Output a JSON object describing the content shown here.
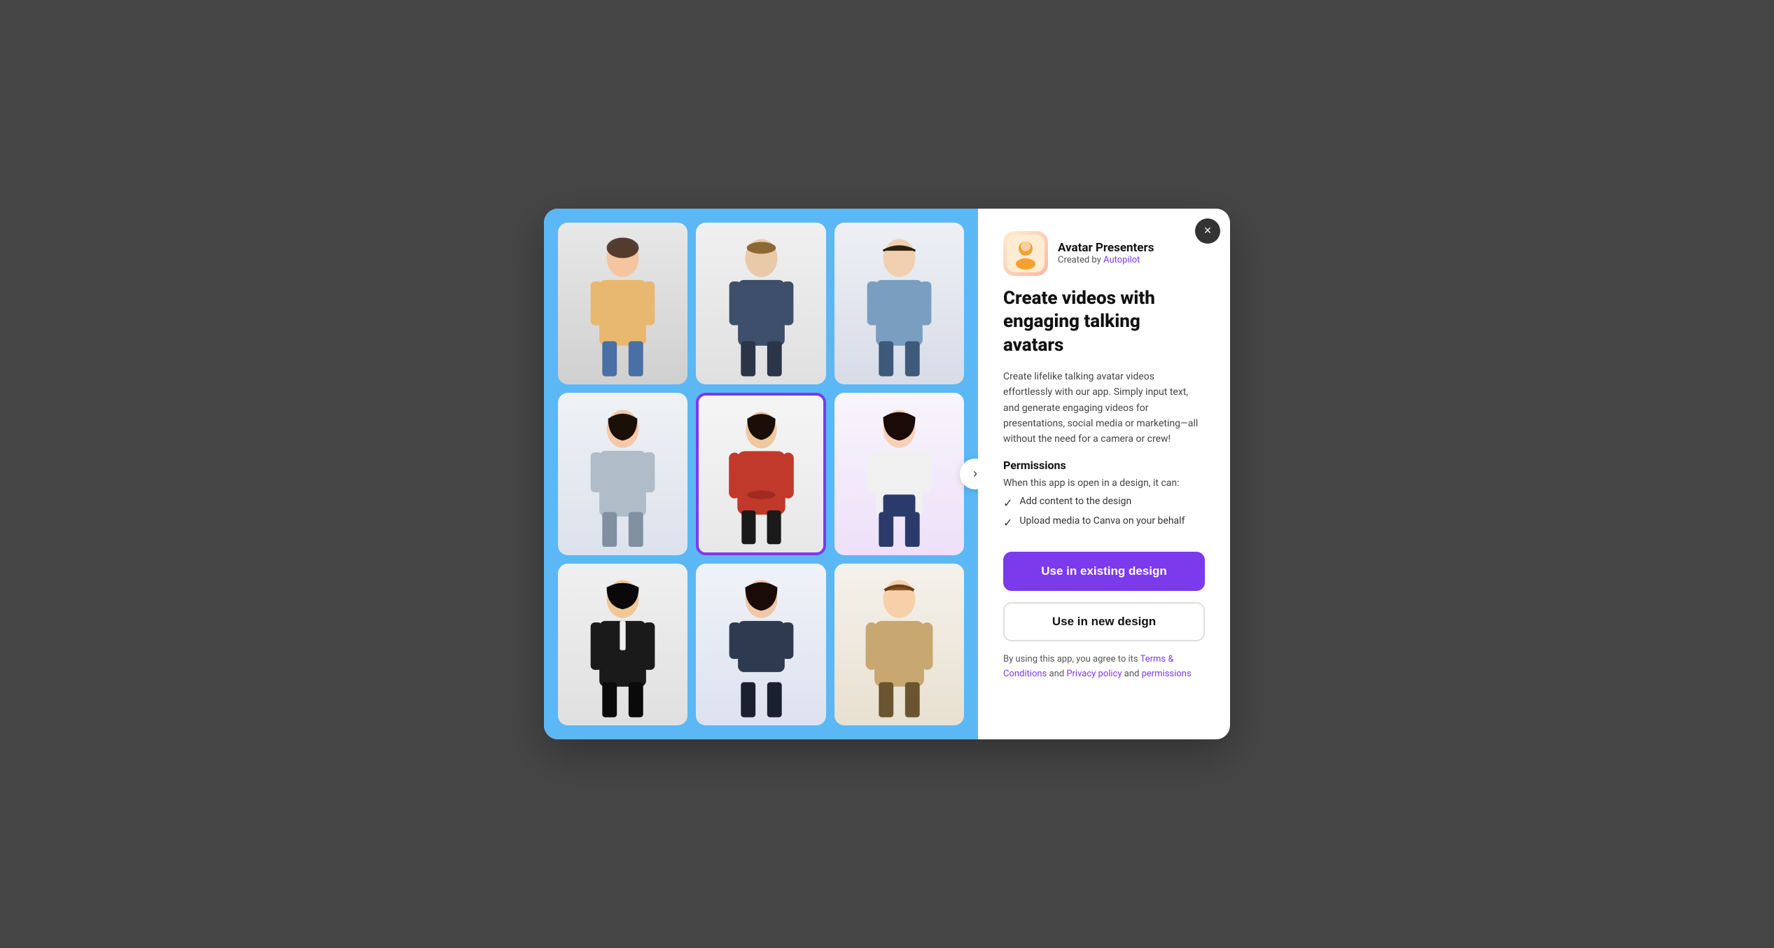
{
  "modal": {
    "close_label": "×",
    "app": {
      "name": "Avatar Presenters",
      "created_by_label": "Created by",
      "creator": "Autopilot"
    },
    "title": "Create videos with engaging talking avatars",
    "description": "Create lifelike talking avatar videos effortlessly with our app. Simply input text, and generate engaging videos for presentations, social media or marketing—all without the need for a camera or crew!",
    "permissions": {
      "section_title": "Permissions",
      "intro": "When this app is open in a design, it can:",
      "items": [
        "Add content to the design",
        "Upload media to Canva on your behalf"
      ]
    },
    "buttons": {
      "use_existing": "Use in existing design",
      "use_new": "Use in new design"
    },
    "terms": {
      "prefix": "By using this app, you agree to its",
      "terms_label": "Terms & Conditions",
      "and1": "and",
      "privacy_label": "Privacy policy",
      "and2": "and",
      "permissions_label": "permissions"
    }
  },
  "avatars": [
    {
      "id": 1,
      "label": "woman-orange-top",
      "selected": false,
      "color": "#e8b870"
    },
    {
      "id": 2,
      "label": "man-dark-shirt",
      "selected": false,
      "color": "#3d4f6b"
    },
    {
      "id": 3,
      "label": "man-blue-shirt",
      "selected": false,
      "color": "#7a9ec0"
    },
    {
      "id": 4,
      "label": "woman-gray-dress",
      "selected": false,
      "color": "#b0bcc8"
    },
    {
      "id": 5,
      "label": "man-red-sweater",
      "selected": true,
      "color": "#c0392b"
    },
    {
      "id": 6,
      "label": "woman-white-top",
      "selected": false,
      "color": "#dce0e8"
    },
    {
      "id": 7,
      "label": "man-black-suit",
      "selected": false,
      "color": "#2c2c2c"
    },
    {
      "id": 8,
      "label": "woman-dark-tshirt",
      "selected": false,
      "color": "#2d3a4f"
    },
    {
      "id": 9,
      "label": "man-beige-sweater",
      "selected": false,
      "color": "#c8a870"
    }
  ]
}
